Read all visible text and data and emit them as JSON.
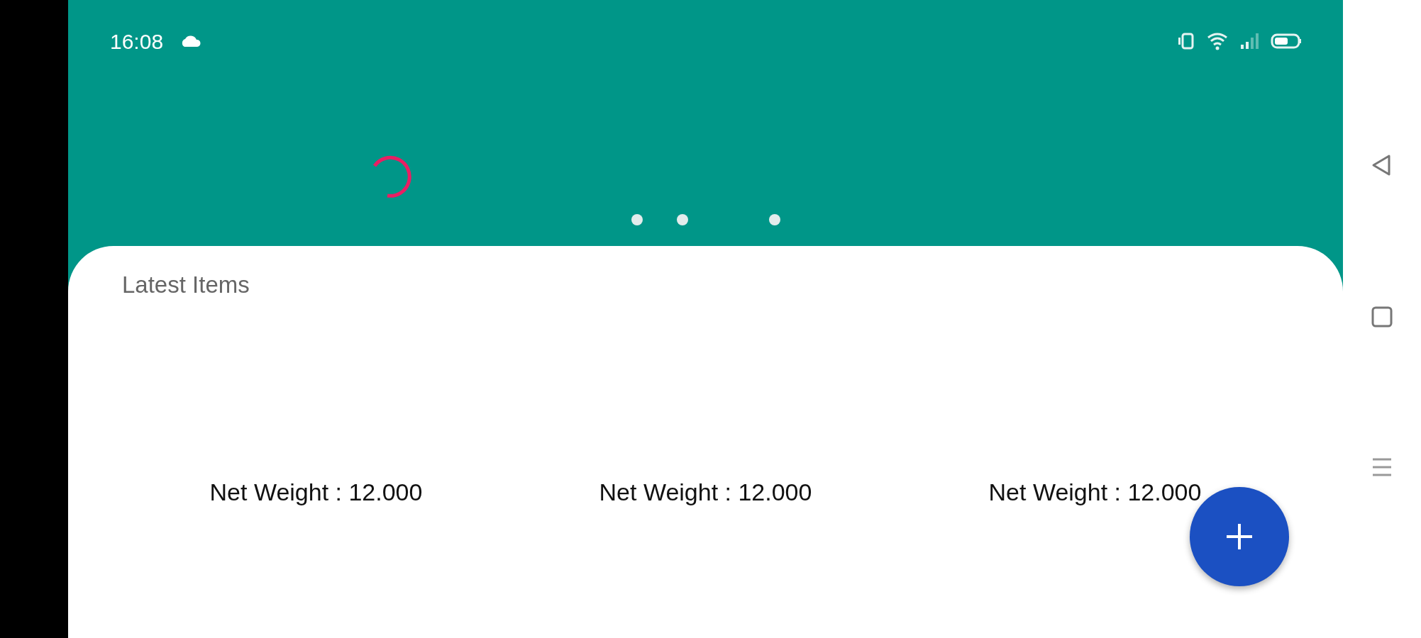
{
  "status_bar": {
    "time": "16:08"
  },
  "section_title": "Latest Items",
  "items": [
    {
      "net_weight": "Net Weight : 12.000"
    },
    {
      "net_weight": "Net Weight : 12.000"
    },
    {
      "net_weight": "Net Weight : 12.000"
    }
  ]
}
